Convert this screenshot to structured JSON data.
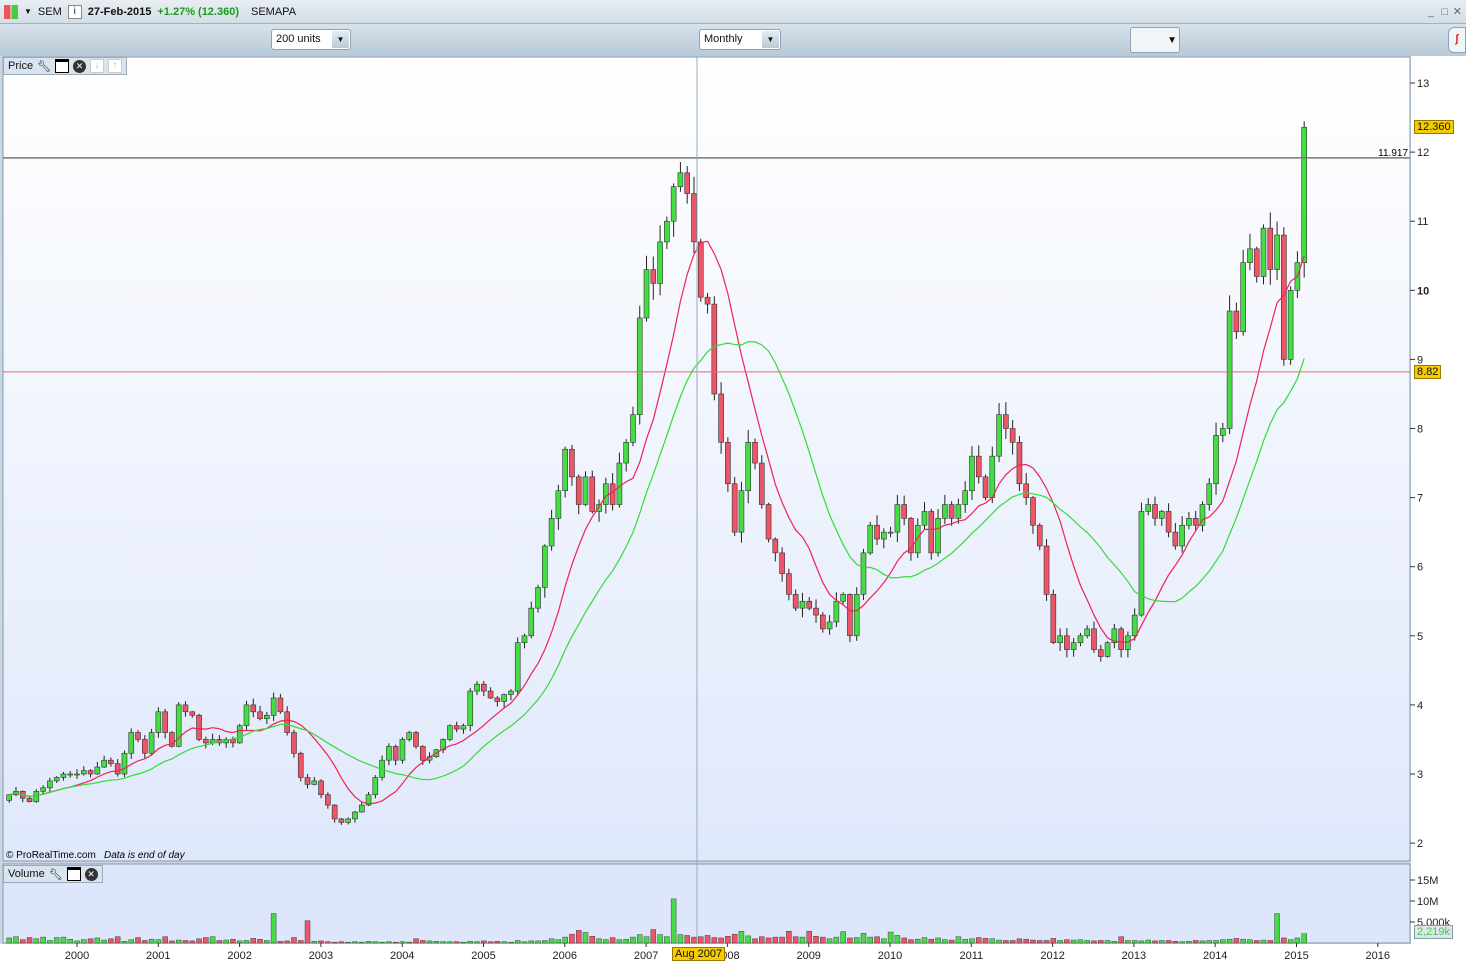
{
  "header": {
    "symbol": "SEM",
    "date": "27-Feb-2015",
    "change": "+1.27% (12.360)",
    "name": "SEMAPA",
    "info_icon": "i"
  },
  "toolbar": {
    "units": "200 units",
    "period": "Monthly"
  },
  "price_panel": {
    "label": "Price",
    "watermark": "© ProRealTime.com",
    "note": "Data is end of day",
    "last_price": "12.360",
    "hline_label": "11.917",
    "cursor_price": "8.82",
    "cursor_date": "Aug 2007"
  },
  "volume_panel": {
    "label": "Volume",
    "last_volume": "2,219k"
  },
  "colors": {
    "up": "#44dd44",
    "down": "#ee5566",
    "ma_short": "#ee2255",
    "ma_long": "#33dd33",
    "hline": "#777777",
    "cursor_line": "#ee6666"
  },
  "chart_data": {
    "type": "candlestick",
    "title": "SEMAPA monthly",
    "start": "Mar 1999",
    "end": "Feb 2015",
    "interval": "month",
    "y_ticks": [
      "2",
      "3",
      "4",
      "5",
      "6",
      "7",
      "8",
      "9",
      "10",
      "11",
      "12",
      "13"
    ],
    "ylim": [
      2,
      13
    ],
    "x_ticks": [
      "2000",
      "2001",
      "2002",
      "2003",
      "2004",
      "2005",
      "2006",
      "2007",
      "2008",
      "2009",
      "2010",
      "2011",
      "2012",
      "2013",
      "2014",
      "2015",
      "2016"
    ],
    "vol_ticks": [
      "5,000k",
      "10M",
      "15M"
    ],
    "ma_periods": [
      10,
      20
    ],
    "closes": [
      2.7,
      2.75,
      2.65,
      2.6,
      2.75,
      2.8,
      2.9,
      2.95,
      3.0,
      3.0,
      3.0,
      3.05,
      3.0,
      3.1,
      3.2,
      3.15,
      3.0,
      3.3,
      3.6,
      3.5,
      3.3,
      3.6,
      3.9,
      3.6,
      3.4,
      4.0,
      3.9,
      3.85,
      3.5,
      3.45,
      3.5,
      3.45,
      3.5,
      3.45,
      3.7,
      4.0,
      3.9,
      3.8,
      3.85,
      4.1,
      3.9,
      3.6,
      3.3,
      2.95,
      2.85,
      2.9,
      2.7,
      2.55,
      2.35,
      2.3,
      2.35,
      2.45,
      2.55,
      2.7,
      2.95,
      3.2,
      3.4,
      3.2,
      3.5,
      3.6,
      3.4,
      3.2,
      3.25,
      3.35,
      3.5,
      3.7,
      3.65,
      3.7,
      4.2,
      4.3,
      4.2,
      4.1,
      4.05,
      4.15,
      4.2,
      4.9,
      5.0,
      5.4,
      5.7,
      6.3,
      6.7,
      7.1,
      7.7,
      7.3,
      6.9,
      7.3,
      6.8,
      6.9,
      7.2,
      6.9,
      7.5,
      7.8,
      8.2,
      9.6,
      10.3,
      10.1,
      10.7,
      11.0,
      11.5,
      11.7,
      11.4,
      10.7,
      9.9,
      9.8,
      8.5,
      7.8,
      7.2,
      6.5,
      7.1,
      7.8,
      7.5,
      6.9,
      6.4,
      6.2,
      5.9,
      5.6,
      5.4,
      5.5,
      5.4,
      5.3,
      5.1,
      5.2,
      5.5,
      5.6,
      5.0,
      5.6,
      6.2,
      6.6,
      6.4,
      6.5,
      6.5,
      6.9,
      6.7,
      6.2,
      6.6,
      6.8,
      6.2,
      6.7,
      6.9,
      6.7,
      6.9,
      7.1,
      7.6,
      7.3,
      7.0,
      7.6,
      8.2,
      8.0,
      7.8,
      7.2,
      7.0,
      6.6,
      6.3,
      5.6,
      4.9,
      5.0,
      4.8,
      4.9,
      5.0,
      5.1,
      4.8,
      4.7,
      4.9,
      5.1,
      4.8,
      5.0,
      5.3,
      6.8,
      6.9,
      6.7,
      6.8,
      6.5,
      6.3,
      6.6,
      6.7,
      6.6,
      6.9,
      7.2,
      7.9,
      8.0,
      9.7,
      9.4,
      10.4,
      10.6,
      10.2,
      10.9,
      10.3,
      10.8,
      9.0,
      10.0,
      10.4,
      12.36
    ],
    "volumes_millions": [
      1.2,
      1.5,
      0.8,
      1.3,
      1.0,
      1.4,
      0.6,
      1.3,
      1.4,
      0.9,
      0.5,
      0.8,
      1.0,
      1.2,
      0.7,
      1.0,
      1.5,
      0.4,
      0.8,
      1.3,
      0.6,
      0.9,
      0.8,
      1.5,
      0.5,
      0.7,
      0.6,
      0.5,
      1.0,
      1.3,
      1.5,
      0.6,
      0.7,
      0.9,
      0.5,
      0.6,
      1.1,
      0.9,
      0.6,
      7.0,
      0.4,
      0.5,
      1.3,
      0.6,
      5.3,
      0.4,
      0.5,
      0.3,
      0.2,
      0.3,
      0.2,
      0.3,
      0.2,
      0.4,
      0.3,
      0.2,
      0.3,
      0.2,
      0.3,
      0.2,
      1.0,
      0.6,
      0.5,
      0.4,
      0.3,
      0.3,
      0.3,
      0.2,
      0.4,
      0.3,
      0.5,
      0.3,
      0.4,
      0.3,
      0.2,
      0.6,
      0.3,
      0.5,
      0.5,
      0.6,
      1.0,
      0.8,
      1.4,
      2.1,
      3.0,
      2.5,
      1.6,
      1.0,
      0.8,
      1.3,
      0.8,
      0.9,
      1.4,
      2.0,
      1.5,
      3.2,
      2.0,
      1.5,
      10.5,
      2.0,
      1.8,
      1.4,
      1.5,
      1.8,
      1.3,
      1.2,
      1.6,
      2.1,
      2.8,
      1.7,
      1.0,
      1.5,
      1.2,
      1.4,
      1.4,
      2.8,
      1.5,
      1.4,
      2.8,
      1.6,
      1.4,
      1.0,
      1.4,
      2.7,
      1.2,
      1.3,
      2.3,
      1.4,
      1.5,
      1.0,
      2.6,
      1.8,
      1.2,
      0.8,
      0.9,
      1.3,
      0.9,
      1.2,
      0.8,
      0.7,
      1.5,
      0.9,
      1.0,
      1.3,
      1.1,
      1.0,
      0.7,
      0.6,
      0.6,
      1.0,
      0.9,
      0.7,
      0.6,
      0.6,
      1.1,
      0.6,
      0.8,
      0.7,
      0.8,
      0.6,
      0.5,
      0.6,
      0.6,
      0.4,
      1.5,
      0.6,
      0.6,
      0.5,
      0.7,
      0.5,
      0.6,
      0.6,
      0.4,
      0.3,
      0.4,
      0.6,
      0.5,
      0.6,
      0.6,
      0.8,
      0.9,
      1.1,
      0.9,
      0.8,
      0.6,
      0.7,
      0.6,
      7.0,
      1.2,
      0.8,
      1.2,
      2.2
    ]
  }
}
